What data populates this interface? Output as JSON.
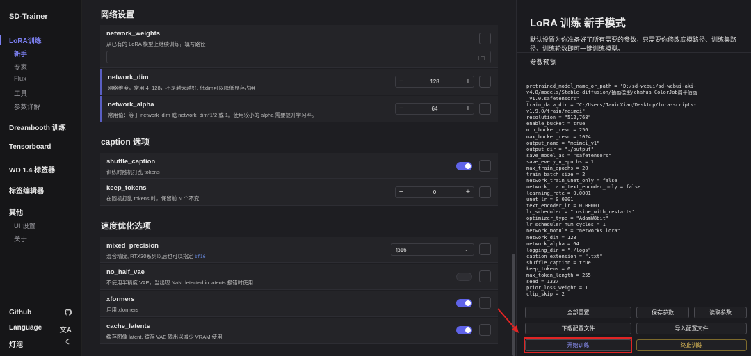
{
  "sidebar": {
    "brand": "SD-Trainer",
    "groups": {
      "lora": "LoRA训练",
      "dreambooth": "Dreambooth 训练",
      "tensorboard": "Tensorboard",
      "wd14": "WD 1.4 标签器",
      "tag_editor": "标签编辑器",
      "other": "其他"
    },
    "lora_items": [
      "新手",
      "专家",
      "Flux",
      "工具",
      "参数详解"
    ],
    "other_items": [
      "UI 设置",
      "关于"
    ],
    "bottom": [
      {
        "label": "Github",
        "icon": "github-icon"
      },
      {
        "label": "Language",
        "icon": "translate-icon"
      },
      {
        "label": "灯泡",
        "icon": "moon-icon"
      }
    ]
  },
  "main": {
    "sections": {
      "network": "网络设置",
      "caption": "caption 选项",
      "speed": "速度优化选项"
    },
    "network_weights": {
      "name": "network_weights",
      "desc": "从已有的 LoRA 模型上继续训练，填写路径",
      "value": ""
    },
    "network_dim": {
      "name": "network_dim",
      "desc": "网络维度，常用 4~128，不是越大越好, 低dim可以降低显存占用",
      "value": "128"
    },
    "network_alpha": {
      "name": "network_alpha",
      "desc": "常用值：等于 network_dim 或 network_dim*1/2 或 1。使用较小的 alpha 需要提升学习率。",
      "value": "64"
    },
    "shuffle_caption": {
      "name": "shuffle_caption",
      "desc": "训练时随机打乱 tokens",
      "on": true
    },
    "keep_tokens": {
      "name": "keep_tokens",
      "desc": "在随机打乱 tokens 时，保留前 N 个不变",
      "value": "0"
    },
    "mixed_precision": {
      "name": "mixed_precision",
      "desc": "混合精度, RTX30系列以后也可以指定",
      "desc_code": "bf16",
      "value": "fp16"
    },
    "no_half_vae": {
      "name": "no_half_vae",
      "desc": "不使用半精度 VAE，当出现 NaN detected in latents 报错时使用",
      "on": false
    },
    "xformers": {
      "name": "xformers",
      "desc": "启用 xformers",
      "on": true
    },
    "cache_latents": {
      "name": "cache_latents",
      "desc": "缓存图像 latent, 缓存 VAE 输出以减少 VRAM 使用",
      "on": true
    },
    "dots_label": "···",
    "minus": "−",
    "plus": "+",
    "folder_icon": "🗀",
    "chevron": "⌄"
  },
  "panel": {
    "title": "LoRA 训练 新手模式",
    "desc": "默认设置为你准备好了所有需要的参数，只需要你修改底模路径、训练集路径、训练轮数即可一键训练模型。",
    "preview_title": "参数预览",
    "config_lines": [
      "pretrained_model_name_or_path = \"D:/sd-webui/sd-webui-aki-",
      "v4.8/models/Stable-diffusion/插画模型/chahua_ColorJob扁平插画",
      "_v1.0.safetensors\"",
      "train_data_dir = \"C:/Users/JanicXiao/Desktop/lora-scripts-",
      "v1.9.0/train/meimei\"",
      "resolution = \"512,768\"",
      "enable_bucket = true",
      "min_bucket_reso = 256",
      "max_bucket_reso = 1024",
      "output_name = \"meimei_v1\"",
      "output_dir = \"./output\"",
      "save_model_as = \"safetensors\"",
      "save_every_n_epochs = 1",
      "max_train_epochs = 20",
      "train_batch_size = 2",
      "network_train_unet_only = false",
      "network_train_text_encoder_only = false",
      "learning_rate = 0.0001",
      "unet_lr = 0.0001",
      "text_encoder_lr = 0.00001",
      "lr_scheduler = \"cosine_with_restarts\"",
      "optimizer_type = \"AdamW8bit\"",
      "lr_scheduler_num_cycles = 1",
      "network_module = \"networks.lora\"",
      "network_dim = 128",
      "network_alpha = 64",
      "logging_dir = \"./logs\"",
      "caption_extension = \".txt\"",
      "shuffle_caption = true",
      "keep_tokens = 0",
      "max_token_length = 255",
      "seed = 1337",
      "prior_loss_weight = 1",
      "clip_skip = 2"
    ],
    "buttons": {
      "reset_all": "全部重置",
      "save_params": "保存参数",
      "read_params": "读取参数",
      "download_config": "下载配置文件",
      "import_config": "导入配置文件",
      "start": "开始训练",
      "stop": "终止训练"
    }
  },
  "colors": {
    "accent": "#7b7ff0",
    "toggle_on": "#5f63e8",
    "stop": "#e6c25a",
    "highlight_box": "#e02424"
  }
}
